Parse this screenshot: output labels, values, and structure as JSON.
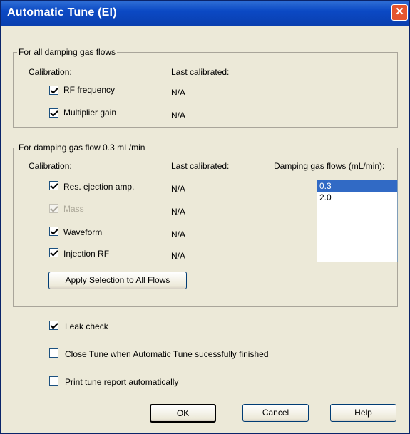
{
  "window": {
    "title": "Automatic Tune (EI)",
    "close_symbol": "✕"
  },
  "group1": {
    "legend": "For all damping gas flows",
    "calibration_header": "Calibration:",
    "last_calibrated_header": "Last calibrated:",
    "items": [
      {
        "label": "RF frequency",
        "checked": true,
        "last": "N/A"
      },
      {
        "label": "Multiplier gain",
        "checked": true,
        "last": "N/A"
      }
    ]
  },
  "group2": {
    "legend": "For damping gas flow 0.3 mL/min",
    "calibration_header": "Calibration:",
    "last_calibrated_header": "Last calibrated:",
    "flows_header": "Damping gas flows (mL/min):",
    "items": [
      {
        "label": "Res. ejection amp.",
        "checked": true,
        "disabled": false,
        "last": "N/A"
      },
      {
        "label": "Mass",
        "checked": true,
        "disabled": true,
        "last": "N/A"
      },
      {
        "label": "Waveform",
        "checked": true,
        "disabled": false,
        "last": "N/A"
      },
      {
        "label": "Injection RF",
        "checked": true,
        "disabled": false,
        "last": "N/A"
      }
    ],
    "flows": [
      {
        "value": "0.3",
        "selected": true
      },
      {
        "value": "2.0",
        "selected": false
      }
    ],
    "apply_button": "Apply Selection to All Flows"
  },
  "options": [
    {
      "label": "Leak check",
      "checked": true
    },
    {
      "label": "Close Tune when Automatic Tune sucessfully finished",
      "checked": false
    },
    {
      "label": "Print tune report automatically",
      "checked": false
    }
  ],
  "buttons": {
    "ok": "OK",
    "cancel": "Cancel",
    "help": "Help"
  }
}
